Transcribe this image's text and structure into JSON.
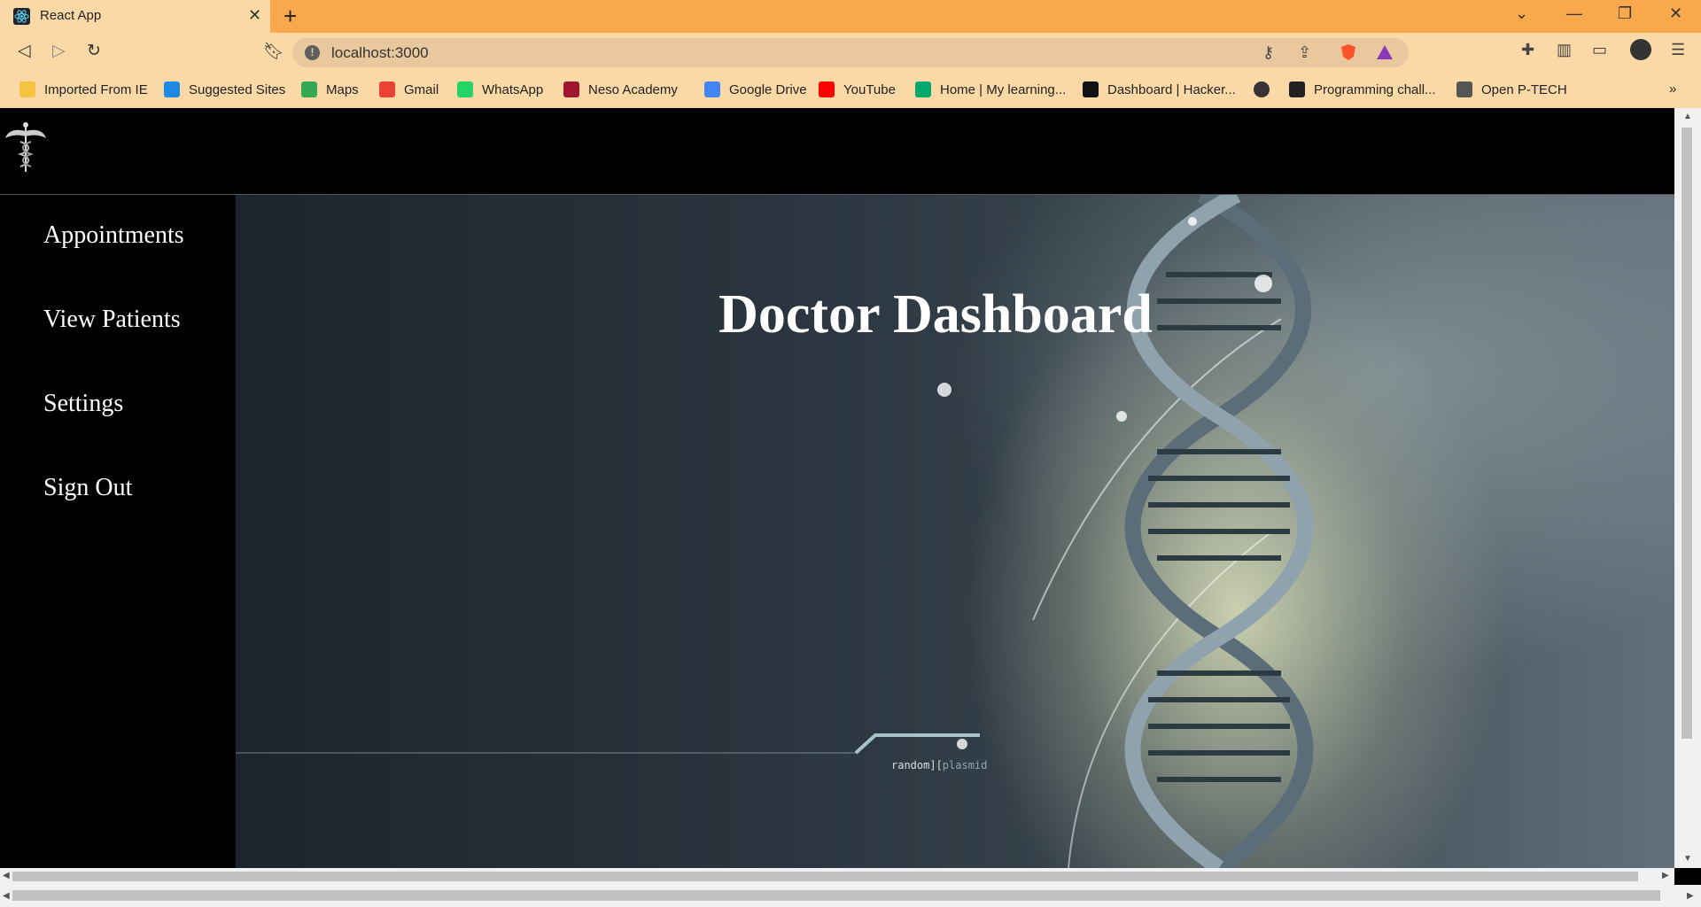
{
  "browser": {
    "tab_title": "React App",
    "url": "localhost:3000",
    "bookmarks": [
      {
        "label": "Imported From IE",
        "icon": "folder-icon",
        "color": "#f5c242"
      },
      {
        "label": "Suggested Sites",
        "icon": "bing-icon",
        "color": "#1e88e5"
      },
      {
        "label": "Maps",
        "icon": "maps-icon",
        "color": "#34a853"
      },
      {
        "label": "Gmail",
        "icon": "gmail-icon",
        "color": "#ea4335"
      },
      {
        "label": "WhatsApp",
        "icon": "whatsapp-icon",
        "color": "#25d366"
      },
      {
        "label": "Neso Academy",
        "icon": "neso-icon",
        "color": "#a0152f"
      },
      {
        "label": "Google Drive",
        "icon": "drive-icon",
        "color": "#4285f4"
      },
      {
        "label": "YouTube",
        "icon": "youtube-icon",
        "color": "#ff0000"
      },
      {
        "label": "Home | My learning...",
        "icon": "w3-icon",
        "color": "#04aa6d"
      },
      {
        "label": "Dashboard | Hacker...",
        "icon": "hackerrank-icon",
        "color": "#111111"
      },
      {
        "label": "",
        "icon": "globe-icon",
        "color": "#333333"
      },
      {
        "label": "Programming chall...",
        "icon": "h-icon",
        "color": "#222222"
      },
      {
        "label": "Open P-TECH",
        "icon": "ptech-icon",
        "color": "#555555"
      }
    ]
  },
  "app": {
    "nav": [
      "Appointments",
      "View Patients",
      "Settings",
      "Sign Out"
    ],
    "hero_title": "Doctor Dashboard",
    "watermark_left": "random][",
    "watermark_right": "plasmid"
  },
  "colors": {
    "chrome_tabbar": "#f9a94b",
    "chrome_toolbar": "#fbd9a7",
    "nav_text": "#ffffff",
    "sidebar_bg": "#000000"
  }
}
